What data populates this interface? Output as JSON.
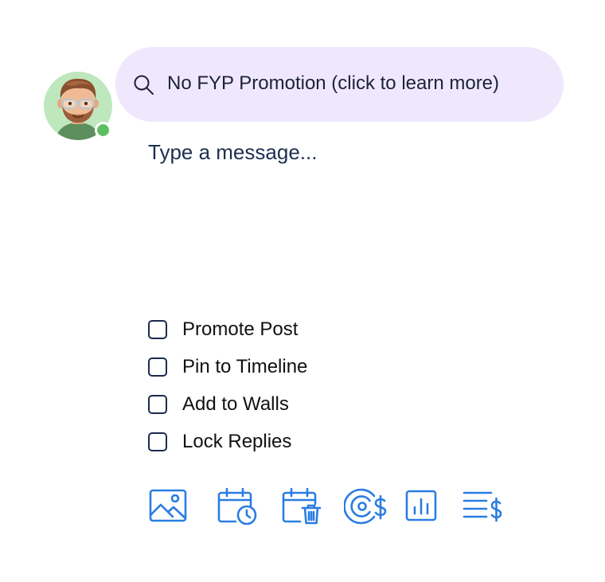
{
  "user": {
    "avatar_icon": "memoji-avatar",
    "status": "online",
    "status_color": "#5cc062"
  },
  "promo_banner": {
    "icon": "search-icon",
    "text": "No FYP Promotion (click to learn more)",
    "background": "#efe8fd"
  },
  "composer": {
    "placeholder": "Type a message...",
    "value": ""
  },
  "options": [
    {
      "label": "Promote Post",
      "checked": false
    },
    {
      "label": "Pin to Timeline",
      "checked": false
    },
    {
      "label": "Add to Walls",
      "checked": false
    },
    {
      "label": "Lock Replies",
      "checked": false
    }
  ],
  "toolbar": {
    "accent_color": "#2a7de1",
    "tools": [
      {
        "icon": "image-icon"
      },
      {
        "icon": "calendar-clock-icon"
      },
      {
        "icon": "calendar-trash-icon"
      },
      {
        "icon": "target-dollar-icon"
      },
      {
        "icon": "bar-chart-icon"
      },
      {
        "icon": "list-dollar-icon"
      }
    ]
  }
}
